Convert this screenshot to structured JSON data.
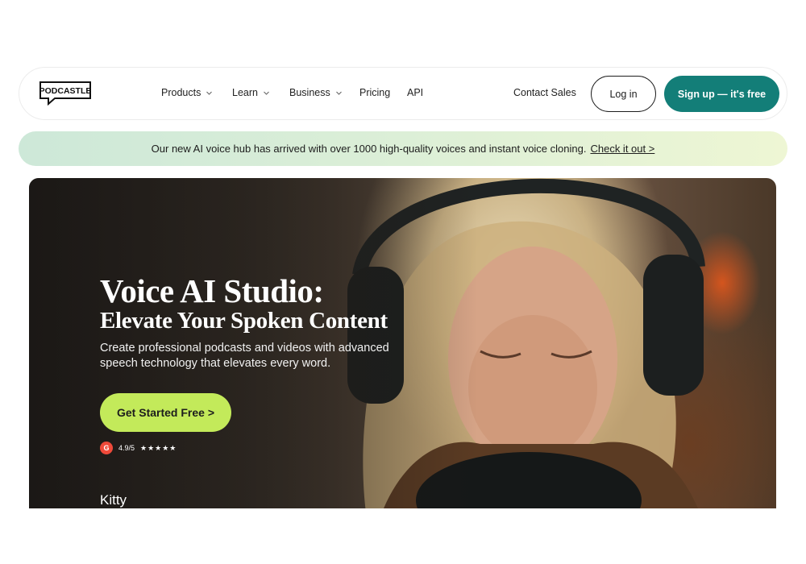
{
  "nav": {
    "logo_text": "PODCASTLE",
    "items": [
      {
        "label": "Products",
        "has_dropdown": true
      },
      {
        "label": "Learn",
        "has_dropdown": true
      },
      {
        "label": "Business",
        "has_dropdown": true
      },
      {
        "label": "Pricing",
        "has_dropdown": false
      },
      {
        "label": "API",
        "has_dropdown": false
      }
    ],
    "contact_sales": "Contact Sales",
    "login_label": "Log in",
    "signup_label": "Sign up — it's free"
  },
  "banner": {
    "text": "Our new AI voice hub has arrived with over 1000 high-quality voices and instant voice cloning.",
    "link_label": "Check it out >"
  },
  "hero": {
    "title_line1": "Voice AI Studio:",
    "title_line2": "Elevate Your Spoken Content",
    "description": "Create professional podcasts and videos with advanced speech technology that elevates every word.",
    "cta_label": "Get Started Free >",
    "rating_badge": "G",
    "rating_text": "4.9/5",
    "rating_stars": "★★★★★",
    "person_name": "Kitty"
  },
  "colors": {
    "brand_teal": "#137e78",
    "cta_lime": "#c3ea5a",
    "banner_start": "#cde8d8",
    "banner_end": "#eef6d4",
    "g2_red": "#ef4a3a"
  },
  "icons": [
    "chevron-down-icon",
    "g2-logo-icon",
    "star-icon"
  ]
}
